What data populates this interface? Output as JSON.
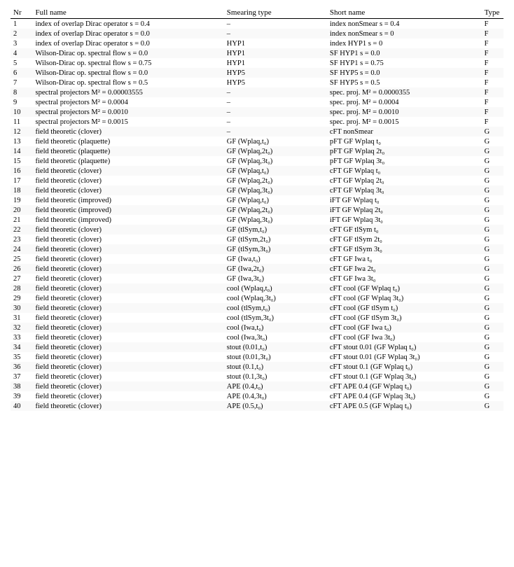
{
  "table": {
    "columns": [
      "Nr",
      "Full name",
      "Smearing type",
      "Short name",
      "Type"
    ],
    "rows": [
      {
        "nr": "1",
        "fullname": "index of overlap Dirac operator s = 0.4",
        "smearing": "–",
        "shortname": "index nonSmear s = 0.4",
        "type": "F"
      },
      {
        "nr": "2",
        "fullname": "index of overlap Dirac operator s = 0.0",
        "smearing": "–",
        "shortname": "index nonSmear s = 0",
        "type": "F"
      },
      {
        "nr": "3",
        "fullname": "index of overlap Dirac operator s = 0.0",
        "smearing": "HYP1",
        "shortname": "index HYP1 s = 0",
        "type": "F"
      },
      {
        "nr": "4",
        "fullname": "Wilson-Dirac op. spectral flow s = 0.0",
        "smearing": "HYP1",
        "shortname": "SF HYP1 s = 0.0",
        "type": "F"
      },
      {
        "nr": "5",
        "fullname": "Wilson-Dirac op. spectral flow s = 0.75",
        "smearing": "HYP1",
        "shortname": "SF HYP1 s = 0.75",
        "type": "F"
      },
      {
        "nr": "6",
        "fullname": "Wilson-Dirac op. spectral flow s = 0.0",
        "smearing": "HYP5",
        "shortname": "SF HYP5 s = 0.0",
        "type": "F"
      },
      {
        "nr": "7",
        "fullname": "Wilson-Dirac op. spectral flow s = 0.5",
        "smearing": "HYP5",
        "shortname": "SF HYP5 s = 0.5",
        "type": "F"
      },
      {
        "nr": "8",
        "fullname": "spectral projectors M² = 0.00003555",
        "smearing": "–",
        "shortname": "spec. proj. M² = 0.0000355",
        "type": "F"
      },
      {
        "nr": "9",
        "fullname": "spectral projectors M² = 0.0004",
        "smearing": "–",
        "shortname": "spec. proj. M² = 0.0004",
        "type": "F"
      },
      {
        "nr": "10",
        "fullname": "spectral projectors M² = 0.0010",
        "smearing": "–",
        "shortname": "spec. proj. M² = 0.0010",
        "type": "F"
      },
      {
        "nr": "11",
        "fullname": "spectral projectors M² = 0.0015",
        "smearing": "–",
        "shortname": "spec. proj. M² = 0.0015",
        "type": "F"
      },
      {
        "nr": "12",
        "fullname": "field theoretic (clover)",
        "smearing": "–",
        "shortname": "cFT nonSmear",
        "type": "G"
      },
      {
        "nr": "13",
        "fullname": "field theoretic (plaquette)",
        "smearing": "GF (Wplaq,t₀)",
        "shortname": "pFT GF Wplaq t₀",
        "type": "G"
      },
      {
        "nr": "14",
        "fullname": "field theoretic (plaquette)",
        "smearing": "GF (Wplaq,2t₀)",
        "shortname": "pFT GF Wplaq 2t₀",
        "type": "G"
      },
      {
        "nr": "15",
        "fullname": "field theoretic (plaquette)",
        "smearing": "GF (Wplaq,3t₀)",
        "shortname": "pFT GF Wplaq 3t₀",
        "type": "G"
      },
      {
        "nr": "16",
        "fullname": "field theoretic (clover)",
        "smearing": "GF (Wplaq,t₀)",
        "shortname": "cFT GF Wplaq t₀",
        "type": "G"
      },
      {
        "nr": "17",
        "fullname": "field theoretic (clover)",
        "smearing": "GF (Wplaq,2t₀)",
        "shortname": "cFT GF Wplaq 2t₀",
        "type": "G"
      },
      {
        "nr": "18",
        "fullname": "field theoretic (clover)",
        "smearing": "GF (Wplaq,3t₀)",
        "shortname": "cFT GF Wplaq 3t₀",
        "type": "G"
      },
      {
        "nr": "19",
        "fullname": "field theoretic (improved)",
        "smearing": "GF (Wplaq,t₀)",
        "shortname": "iFT GF Wplaq t₀",
        "type": "G"
      },
      {
        "nr": "20",
        "fullname": "field theoretic (improved)",
        "smearing": "GF (Wplaq,2t₀)",
        "shortname": "iFT GF Wplaq 2t₀",
        "type": "G"
      },
      {
        "nr": "21",
        "fullname": "field theoretic (improved)",
        "smearing": "GF (Wplaq,3t₀)",
        "shortname": "iFT GF Wplaq 3t₀",
        "type": "G"
      },
      {
        "nr": "22",
        "fullname": "field theoretic (clover)",
        "smearing": "GF (tlSym,t₀)",
        "shortname": "cFT GF tlSym t₀",
        "type": "G"
      },
      {
        "nr": "23",
        "fullname": "field theoretic (clover)",
        "smearing": "GF (tlSym,2t₀)",
        "shortname": "cFT GF tlSym 2t₀",
        "type": "G"
      },
      {
        "nr": "24",
        "fullname": "field theoretic (clover)",
        "smearing": "GF (tlSym,3t₀)",
        "shortname": "cFT GF tlSym 3t₀",
        "type": "G"
      },
      {
        "nr": "25",
        "fullname": "field theoretic (clover)",
        "smearing": "GF (Iwa,t₀)",
        "shortname": "cFT GF Iwa t₀",
        "type": "G"
      },
      {
        "nr": "26",
        "fullname": "field theoretic (clover)",
        "smearing": "GF (Iwa,2t₀)",
        "shortname": "cFT GF Iwa 2t₀",
        "type": "G"
      },
      {
        "nr": "27",
        "fullname": "field theoretic (clover)",
        "smearing": "GF (Iwa,3t₀)",
        "shortname": "cFT GF Iwa 3t₀",
        "type": "G"
      },
      {
        "nr": "28",
        "fullname": "field theoretic (clover)",
        "smearing": "cool (Wplaq,t₀)",
        "shortname": "cFT cool (GF Wplaq t₀)",
        "type": "G"
      },
      {
        "nr": "29",
        "fullname": "field theoretic (clover)",
        "smearing": "cool (Wplaq,3t₀)",
        "shortname": "cFT cool (GF Wplaq 3t₀)",
        "type": "G"
      },
      {
        "nr": "30",
        "fullname": "field theoretic (clover)",
        "smearing": "cool (tlSym,t₀)",
        "shortname": "cFT cool (GF tlSym t₀)",
        "type": "G"
      },
      {
        "nr": "31",
        "fullname": "field theoretic (clover)",
        "smearing": "cool (tlSym,3t₀)",
        "shortname": "cFT cool (GF tlSym 3t₀)",
        "type": "G"
      },
      {
        "nr": "32",
        "fullname": "field theoretic (clover)",
        "smearing": "cool (Iwa,t₀)",
        "shortname": "cFT cool (GF Iwa t₀)",
        "type": "G"
      },
      {
        "nr": "33",
        "fullname": "field theoretic (clover)",
        "smearing": "cool (Iwa,3t₀)",
        "shortname": "cFT cool (GF Iwa 3t₀)",
        "type": "G"
      },
      {
        "nr": "34",
        "fullname": "field theoretic (clover)",
        "smearing": "stout (0.01,t₀)",
        "shortname": "cFT stout 0.01 (GF Wplaq t₀)",
        "type": "G"
      },
      {
        "nr": "35",
        "fullname": "field theoretic (clover)",
        "smearing": "stout (0.01,3t₀)",
        "shortname": "cFT stout 0.01 (GF Wplaq 3t₀)",
        "type": "G"
      },
      {
        "nr": "36",
        "fullname": "field theoretic (clover)",
        "smearing": "stout (0.1,t₀)",
        "shortname": "cFT stout 0.1 (GF Wplaq t₀)",
        "type": "G"
      },
      {
        "nr": "37",
        "fullname": "field theoretic (clover)",
        "smearing": "stout (0.1,3t₀)",
        "shortname": "cFT stout 0.1 (GF Wplaq 3t₀)",
        "type": "G"
      },
      {
        "nr": "38",
        "fullname": "field theoretic (clover)",
        "smearing": "APE (0.4,t₀)",
        "shortname": "cFT APE 0.4 (GF Wplaq t₀)",
        "type": "G"
      },
      {
        "nr": "39",
        "fullname": "field theoretic (clover)",
        "smearing": "APE (0.4,3t₀)",
        "shortname": "cFT APE 0.4 (GF Wplaq 3t₀)",
        "type": "G"
      },
      {
        "nr": "40",
        "fullname": "field theoretic (clover)",
        "smearing": "APE (0.5,t₀)",
        "shortname": "cFT APE 0.5 (GF Wplaq t₀)",
        "type": "G"
      }
    ]
  }
}
